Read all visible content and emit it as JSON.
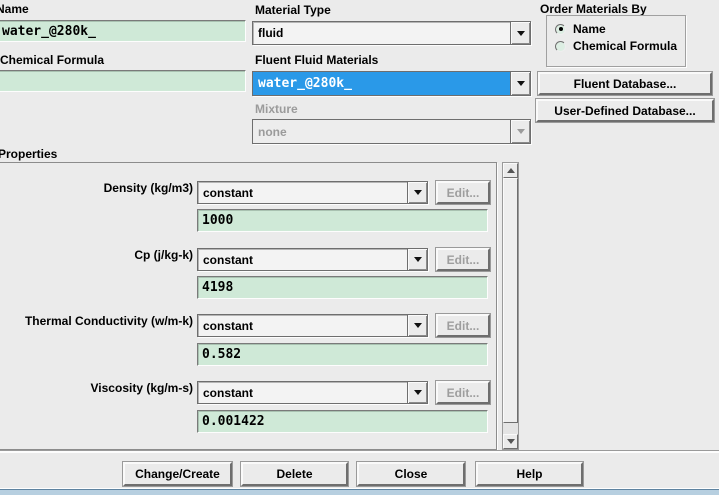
{
  "dialog": {
    "name_label": "Name",
    "name_value": "water_@280k_",
    "chemical_formula_label": "Chemical Formula",
    "chemical_formula_value": "",
    "material_type_label": "Material Type",
    "material_type_value": "fluid",
    "fluent_fluid_materials_label": "Fluent Fluid Materials",
    "fluent_fluid_materials_value": "water_@280k_",
    "mixture_label": "Mixture",
    "mixture_value": "none",
    "order_materials_by": {
      "label": "Order Materials By",
      "options": [
        {
          "label": "Name",
          "selected": true
        },
        {
          "label": "Chemical Formula",
          "selected": false
        }
      ]
    },
    "buttons": {
      "fluent_database": "Fluent Database...",
      "user_defined_database": "User-Defined Database...",
      "change_create": "Change/Create",
      "delete": "Delete",
      "close": "Close",
      "help": "Help"
    },
    "properties": {
      "label": "Properties",
      "rows": [
        {
          "name": "Density (kg/m3)",
          "method": "constant",
          "edit_label": "Edit...",
          "value": "1000"
        },
        {
          "name": "Cp (j/kg-k)",
          "method": "constant",
          "edit_label": "Edit...",
          "value": "4198"
        },
        {
          "name": "Thermal Conductivity (w/m-k)",
          "method": "constant",
          "edit_label": "Edit...",
          "value": "0.582"
        },
        {
          "name": "Viscosity (kg/m-s)",
          "method": "constant",
          "edit_label": "Edit...",
          "value": "0.001422"
        }
      ]
    },
    "colors": {
      "field_green": "#cfe9d7",
      "selection_blue": "#2a99e8",
      "bottom_strip": "#b7cfe0"
    }
  }
}
